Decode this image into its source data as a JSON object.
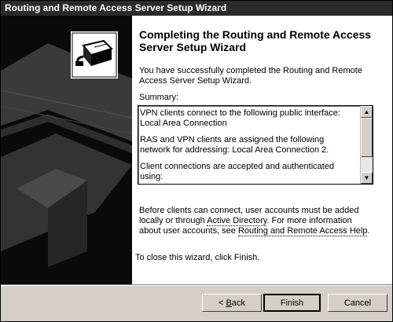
{
  "window": {
    "title": "Routing and Remote Access Server Setup Wizard"
  },
  "main": {
    "heading": "Completing the Routing and Remote Access Server Setup Wizard",
    "intro": "You have successfully completed the Routing and Remote Access Server Setup Wizard.",
    "summary_label": "Summary:",
    "summary_lines": [
      "VPN clients connect to the following public interface: Local Area Connection",
      "RAS and VPN clients are assigned the following network for addressing: Local Area Connection 2.",
      "Client connections are accepted and authenticated using:"
    ],
    "para_before_link1": "Before clients can connect, user accounts must be added locally or through ",
    "link1": "Active Directory",
    "para_between": ". For more information about user accounts, see ",
    "link2": "Routing and Remote Access Help",
    "para_after": ".",
    "closing": "To close this wizard, click Finish."
  },
  "buttons": {
    "back_arrow": "<",
    "back_underlined": "B",
    "back_rest": "ack",
    "finish": "Finish",
    "cancel": "Cancel"
  }
}
